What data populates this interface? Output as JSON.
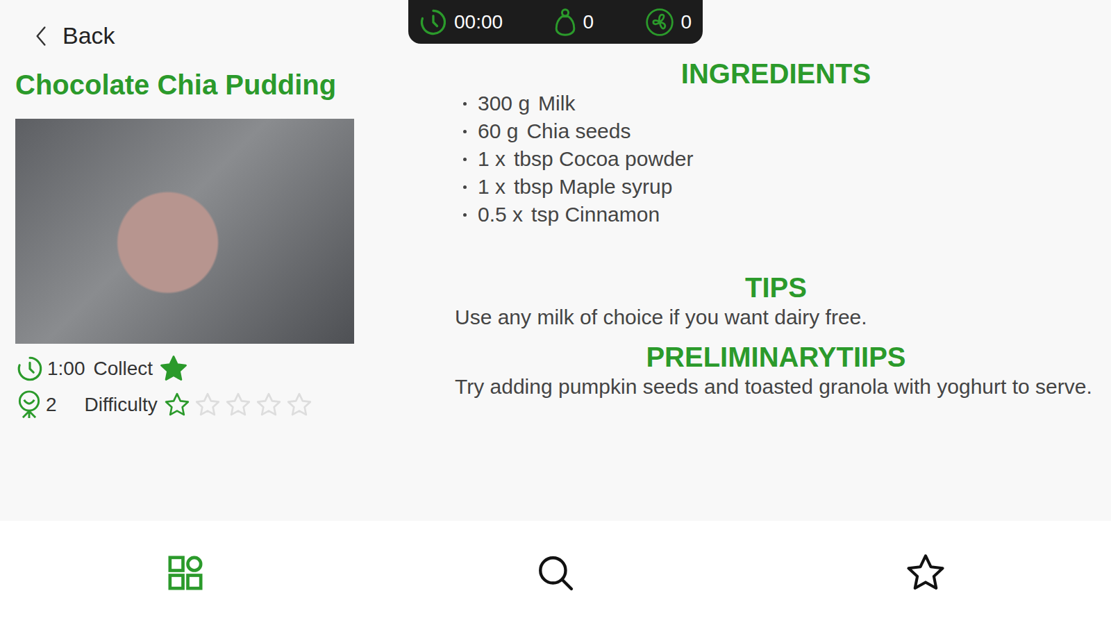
{
  "back": {
    "label": "Back"
  },
  "status": {
    "timer": "00:00",
    "weight": "0",
    "speed": "0"
  },
  "recipe": {
    "title": "Chocolate Chia Pudding",
    "time": "1:00",
    "collect_label": "Collect",
    "collected": true,
    "servings": "2",
    "difficulty_label": "Difficulty",
    "difficulty": {
      "stars": 1,
      "total": 5
    }
  },
  "ingredients": {
    "heading": "INGREDIENTS",
    "items": [
      {
        "amount": "300 g",
        "name": "Milk"
      },
      {
        "amount": "60 g",
        "name": "Chia seeds"
      },
      {
        "amount": "1 x",
        "name": "tbsp Cocoa powder"
      },
      {
        "amount": "1 x",
        "name": "tbsp Maple syrup"
      },
      {
        "amount": "0.5 x",
        "name": "tsp Cinnamon"
      }
    ]
  },
  "tips": {
    "heading": "TIPS",
    "text": "Use any milk of choice if you want dairy free."
  },
  "preliminary_tips": {
    "heading": "PRELIMINARYTIIPS",
    "text": "Try adding pumpkin seeds and toasted granola with yoghurt to serve."
  },
  "nav": [
    {
      "kind": "categories",
      "selected": true
    },
    {
      "kind": "search",
      "selected": false
    },
    {
      "kind": "favorites",
      "selected": false
    }
  ]
}
